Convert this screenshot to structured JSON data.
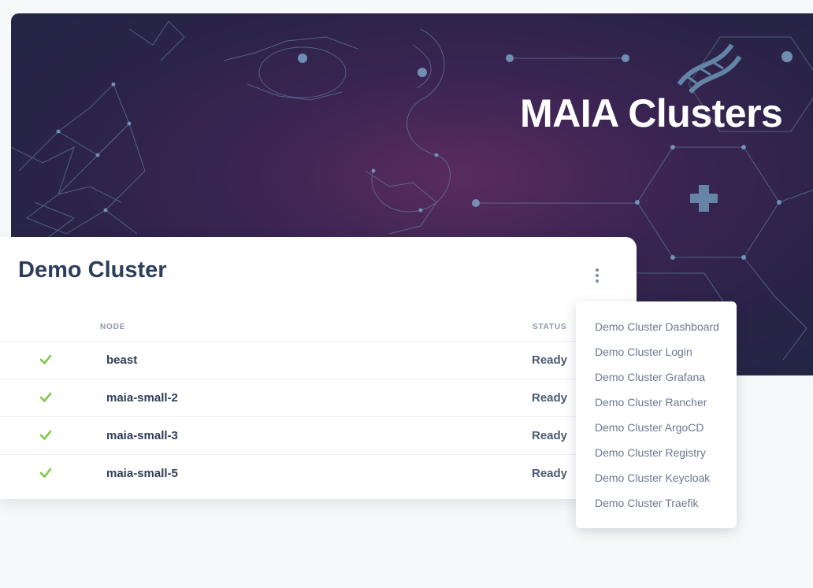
{
  "hero": {
    "title": "MAIA Clusters"
  },
  "card": {
    "title": "Demo Cluster",
    "columns": {
      "node": "NODE",
      "status": "STATUS"
    },
    "rows": [
      {
        "node": "beast",
        "status": "Ready"
      },
      {
        "node": "maia-small-2",
        "status": "Ready"
      },
      {
        "node": "maia-small-3",
        "status": "Ready"
      },
      {
        "node": "maia-small-5",
        "status": "Ready"
      }
    ]
  },
  "menu": {
    "items": [
      "Demo Cluster Dashboard",
      "Demo Cluster Login",
      "Demo Cluster Grafana",
      "Demo Cluster Rancher",
      "Demo Cluster ArgoCD",
      "Demo Cluster Registry",
      "Demo Cluster Keycloak",
      "Demo Cluster Traefik"
    ]
  },
  "colors": {
    "accent_check": "#7ac943",
    "title": "#2c3e5d",
    "hero_bg": "#3a2452"
  }
}
